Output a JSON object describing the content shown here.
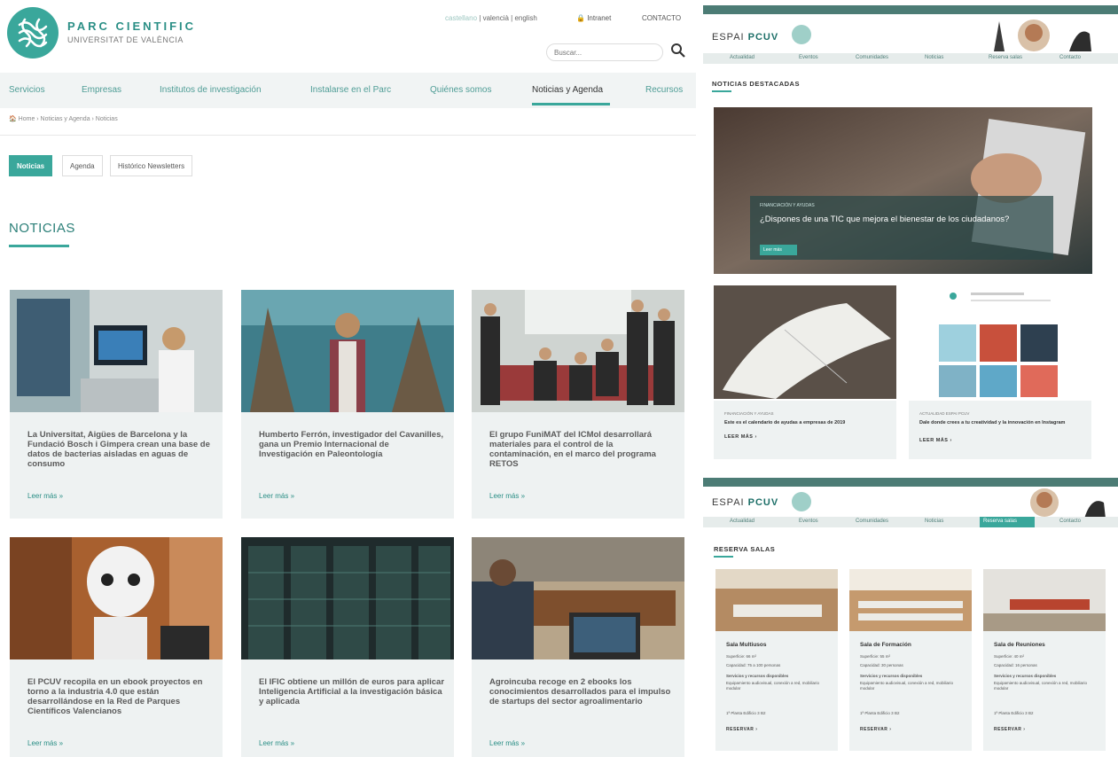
{
  "left": {
    "brand": {
      "title": "PARC CIENTIFIC",
      "subtitle": "UNIVERSITAT DE VALÈNCIA"
    },
    "lang": {
      "selected": "castellano",
      "others": "| valencià | english"
    },
    "intranet": "Intranet",
    "contacto": "CONTACTO",
    "search_placeholder": "Buscar...",
    "nav": [
      "Servicios",
      "Empresas",
      "Institutos de investigación",
      "Instalarse en el Parc",
      "Quiénes somos",
      "Noticias y Agenda",
      "Recursos"
    ],
    "breadcrumb": "🏠 Home  ›  Noticias y Agenda  ›  Noticias",
    "tabs": [
      "Noticias",
      "Agenda",
      "Histórico Newsletters"
    ],
    "section_title": "NOTICIAS",
    "read_more": "Leer más »",
    "cards": [
      {
        "title": "La Universitat, Aigües de Barcelona y la Fundació Bosch i Gimpera crean una base de datos de bacterias aisladas en aguas de consumo"
      },
      {
        "title": "Humberto Ferrón, investigador del Cavanilles, gana un Premio Internacional de Investigación en Paleontología"
      },
      {
        "title": "El grupo FuniMAT del ICMol desarrollará materiales para el control de la contaminación, en el marco del programa RETOS"
      },
      {
        "title": "El PCUV recopila en un ebook proyectos en torno a la industria 4.0 que están desarrollándose en la Red de Parques Científicos Valencianos"
      },
      {
        "title": "El IFIC obtiene un millón de euros para aplicar Inteligencia Artificial a la investigación básica y aplicada"
      },
      {
        "title": "Agroincuba recoge en 2 ebooks los conocimientos desarrollados para el impulso de startups del sector agroalimentario"
      }
    ]
  },
  "rtop": {
    "brand": "ESPAI",
    "brand_bold": "PCUV",
    "nav": [
      "Actualidad",
      "Eventos",
      "Comunidades",
      "Noticias",
      "Reserva salas",
      "Contacto"
    ],
    "section_title": "NOTICIAS DESTACADAS",
    "hero": {
      "category": "FINANCIACIÓN Y AYUDAS",
      "title": "¿Dispones de una TIC que mejora el bienestar de los ciudadanos?",
      "button": "Leer más"
    },
    "subs": [
      {
        "category": "FINANCIACIÓN Y AYUDAS",
        "title": "Este es el calendario de ayudas a empresas de 2019",
        "more": "LEER MÁS ›"
      },
      {
        "category": "ACTUALIDAD ESPAI PCUV",
        "title": "Dale donde crees a tu creatividad y la innovación en Instagram",
        "more": "LEER MÁS ›"
      }
    ]
  },
  "rbot": {
    "brand": "ESPAI",
    "brand_bold": "PCUV",
    "nav": [
      "Actualidad",
      "Eventos",
      "Comunidades",
      "Noticias",
      "Reserva salas",
      "Contacto"
    ],
    "section_title": "RESERVA SALAS",
    "rooms": [
      {
        "name": "Sala Multiusos",
        "lines": [
          "Superficie: 66 m²",
          "Capacidad: 75 a 100 personas",
          "Servicios y recursos disponibles",
          "Equipamiento audiovisual, conexión a red, mobiliario modular",
          "1ª Planta Edificio 3 B2"
        ],
        "reserve": "RESERVAR ›"
      },
      {
        "name": "Sala de Formación",
        "lines": [
          "Superficie: 55 m²",
          "Capacidad: 30 personas",
          "Servicios y recursos disponibles",
          "Equipamiento audiovisual, conexión a red, mobiliario modular",
          "1ª Planta Edificio 3 B2"
        ],
        "reserve": "RESERVAR ›"
      },
      {
        "name": "Sala de Reuniones",
        "lines": [
          "Superficie: 40 m²",
          "Capacidad: 16 personas",
          "Servicios y recursos disponibles",
          "Equipamiento audiovisual, conexión a red, mobiliario modular",
          "1ª Planta Edificio 3 B2"
        ],
        "reserve": "RESERVAR ›"
      }
    ]
  },
  "colors": {
    "accent": "#3aa79b",
    "dark_accent": "#2b7f78",
    "panel": "#eef2f2"
  }
}
